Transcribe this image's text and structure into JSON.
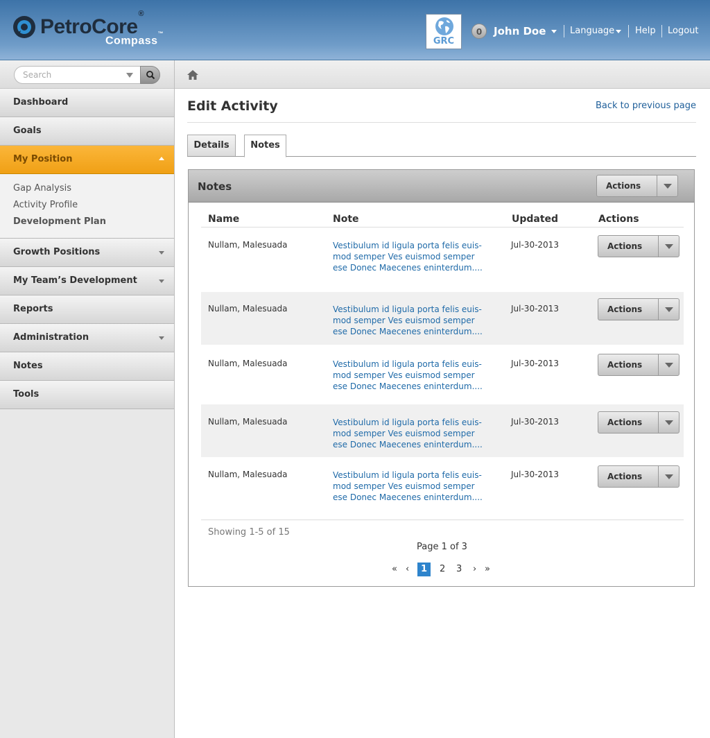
{
  "header": {
    "logo_main": "PetroCore",
    "logo_reg": "®",
    "logo_sub": "Compass",
    "logo_tm": "™",
    "grc_label": "GRC",
    "notif_count": "0",
    "user_name": "John Doe",
    "language_label": "Language",
    "help_label": "Help",
    "logout_label": "Logout"
  },
  "search": {
    "placeholder": "Search"
  },
  "sidebar": {
    "items": [
      {
        "label": "Dashboard"
      },
      {
        "label": "Goals"
      },
      {
        "label": "My Position"
      },
      {
        "label": "Growth Positions"
      },
      {
        "label": "My Team’s Development"
      },
      {
        "label": "Reports"
      },
      {
        "label": "Administration"
      },
      {
        "label": "Notes"
      },
      {
        "label": "Tools"
      }
    ],
    "subitems": [
      {
        "label": "Gap Analysis"
      },
      {
        "label": "Activity Profile"
      },
      {
        "label": "Development Plan"
      }
    ]
  },
  "page": {
    "title": "Edit Activity",
    "back_link": "Back to previous page",
    "tabs": [
      {
        "label": "Details"
      },
      {
        "label": "Notes"
      }
    ]
  },
  "panel": {
    "title": "Notes",
    "actions_label": "Actions",
    "columns": [
      "Name",
      "Note",
      "Updated",
      "Actions"
    ],
    "rows": [
      {
        "name": "Nullam, Malesuada",
        "note_lines": [
          "Vestibulum id ligula porta felis euis-",
          "mod semper Ves euismod semper",
          "ese Donec Maecenes eninterdum...."
        ],
        "updated": "Jul-30-2013",
        "action": "Actions"
      },
      {
        "name": "Nullam, Malesuada",
        "note_lines": [
          "Vestibulum id ligula porta felis euis-",
          "mod semper Ves euismod semper",
          "ese Donec Maecenes eninterdum...."
        ],
        "updated": "Jul-30-2013",
        "action": "Actions"
      },
      {
        "name": "Nullam, Malesuada",
        "note_lines": [
          "Vestibulum id ligula porta felis euis-",
          "mod semper Ves euismod semper",
          "ese Donec Maecenes eninterdum...."
        ],
        "updated": "Jul-30-2013",
        "action": "Actions"
      },
      {
        "name": "Nullam, Malesuada",
        "note_lines": [
          "Vestibulum id ligula porta felis euis-",
          "mod semper Ves euismod semper",
          "ese Donec Maecenes eninterdum...."
        ],
        "updated": "Jul-30-2013",
        "action": "Actions"
      },
      {
        "name": "Nullam, Malesuada",
        "note_lines": [
          "Vestibulum id ligula porta felis euis-",
          "mod semper Ves euismod semper",
          "ese Donec Maecenes eninterdum...."
        ],
        "updated": "Jul-30-2013",
        "action": "Actions"
      }
    ],
    "showing": "Showing 1-5 of 15",
    "page_of": "Page 1 of 3",
    "pager": {
      "first": "«",
      "prev": "‹",
      "pages": [
        "1",
        "2",
        "3"
      ],
      "next": "›",
      "last": "»",
      "current": "1"
    }
  },
  "colors": {
    "header_blue": "#4a7eb5",
    "accent_orange": "#f6a623",
    "link_blue": "#1f6aa8",
    "pager_active": "#2e84cc"
  }
}
